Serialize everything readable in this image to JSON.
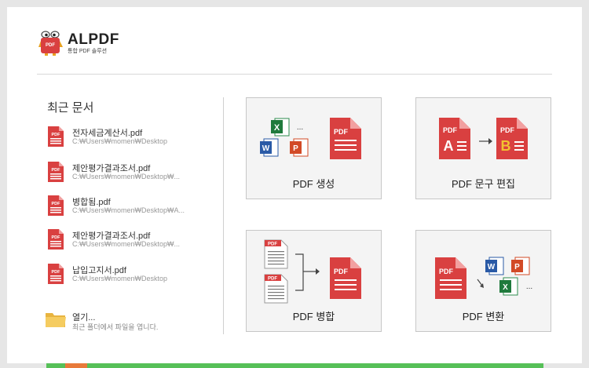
{
  "app": {
    "name": "ALPDF",
    "subtitle": "통합 PDF 솔루션",
    "logo_badge": "PDF"
  },
  "recent": {
    "title": "최근 문서",
    "items": [
      {
        "name": "전자세금계산서.pdf",
        "path": "C:₩Users₩momen₩Desktop"
      },
      {
        "name": "제안평가결과조서.pdf",
        "path": "C:₩Users₩momen₩Desktop₩..."
      },
      {
        "name": "병합됨.pdf",
        "path": "C:₩Users₩momen₩Desktop₩A..."
      },
      {
        "name": "제안평가결과조서.pdf",
        "path": "C:₩Users₩momen₩Desktop₩..."
      },
      {
        "name": "납입고지서.pdf",
        "path": "C:₩Users₩momen₩Desktop"
      }
    ],
    "open": {
      "label": "열기...",
      "hint": "최근 폴더에서 파일을 엽니다."
    }
  },
  "actions": {
    "create": {
      "label": "PDF 생성"
    },
    "edit": {
      "label": "PDF 문구 편집"
    },
    "merge": {
      "label": "PDF 병합"
    },
    "convert": {
      "label": "PDF 변환"
    }
  },
  "icon_text": {
    "pdf": "PDF",
    "excel": "X",
    "word": "W",
    "ppt": "P",
    "edit_from": "A",
    "edit_to": "B",
    "more": "..."
  },
  "colors": {
    "pdf_red": "#d94040",
    "excel_green": "#1f7a3c",
    "word_blue": "#2a5aa6",
    "ppt_orange": "#d24a26",
    "progress_green": "#56c058"
  }
}
